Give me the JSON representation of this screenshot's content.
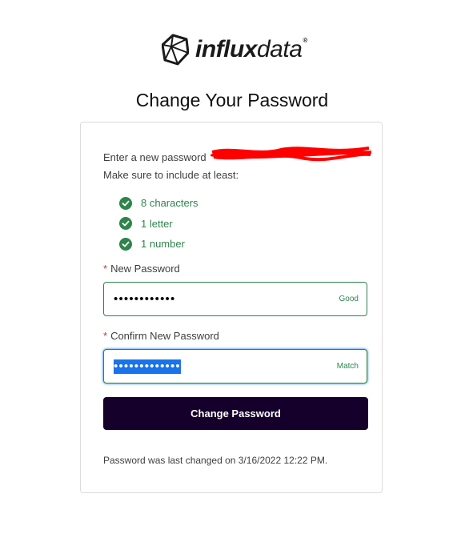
{
  "brand": {
    "logo_bold": "influx",
    "logo_light": "data",
    "logo_mark": "®"
  },
  "page": {
    "title": "Change Your Password"
  },
  "intro": {
    "line1": "Enter a new password",
    "line2": "Make sure to include at least:"
  },
  "requirements": [
    {
      "label": "8 characters",
      "met": true
    },
    {
      "label": "1 letter",
      "met": true
    },
    {
      "label": "1 number",
      "met": true
    }
  ],
  "new_password": {
    "required_mark": "*",
    "label": "New Password",
    "value": "••••••••••••",
    "strength": "Good"
  },
  "confirm_password": {
    "required_mark": "*",
    "label": "Confirm New Password",
    "value": "•••••••••••••",
    "status": "Match"
  },
  "submit": {
    "label": "Change Password"
  },
  "footer": {
    "last_changed": "Password was last changed on 3/16/2022 12:22 PM."
  },
  "colors": {
    "success": "#2e844a",
    "button_bg": "#14002b",
    "required": "#c23934",
    "redaction": "#ff0000"
  }
}
